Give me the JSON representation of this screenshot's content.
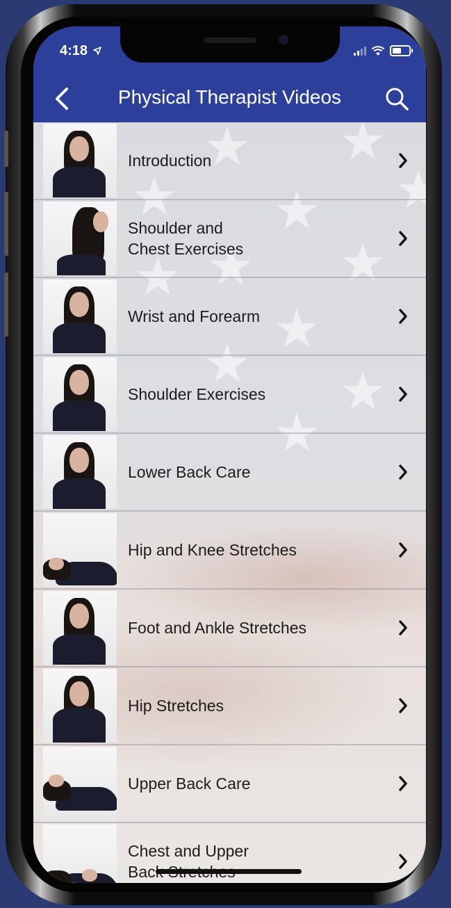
{
  "status_bar": {
    "time": "4:18"
  },
  "header": {
    "title": "Physical Therapist Videos",
    "back_icon": "chevron-left-icon",
    "search_icon": "search-icon"
  },
  "colors": {
    "header_bg": "#2c3f9b",
    "text": "#1c1c1c"
  },
  "videos": [
    {
      "title": "Introduction",
      "lines": [
        "Introduction"
      ]
    },
    {
      "title": "Shoulder and Chest Exercises",
      "lines": [
        "Shoulder and",
        "Chest Exercises"
      ]
    },
    {
      "title": "Wrist and Forearm",
      "lines": [
        "Wrist and Forearm"
      ]
    },
    {
      "title": "Shoulder Exercises",
      "lines": [
        "Shoulder Exercises"
      ]
    },
    {
      "title": "Lower Back Care",
      "lines": [
        "Lower Back Care"
      ]
    },
    {
      "title": "Hip and Knee Stretches",
      "lines": [
        "Hip and Knee Stretches"
      ]
    },
    {
      "title": "Foot and Ankle Stretches",
      "lines": [
        "Foot and Ankle Stretches"
      ]
    },
    {
      "title": "Hip Stretches",
      "lines": [
        "Hip Stretches"
      ]
    },
    {
      "title": "Upper Back Care",
      "lines": [
        "Upper Back Care"
      ]
    },
    {
      "title": "Chest and Upper Back Stretches",
      "lines": [
        "Chest and Upper",
        "Back Stretches"
      ]
    }
  ]
}
